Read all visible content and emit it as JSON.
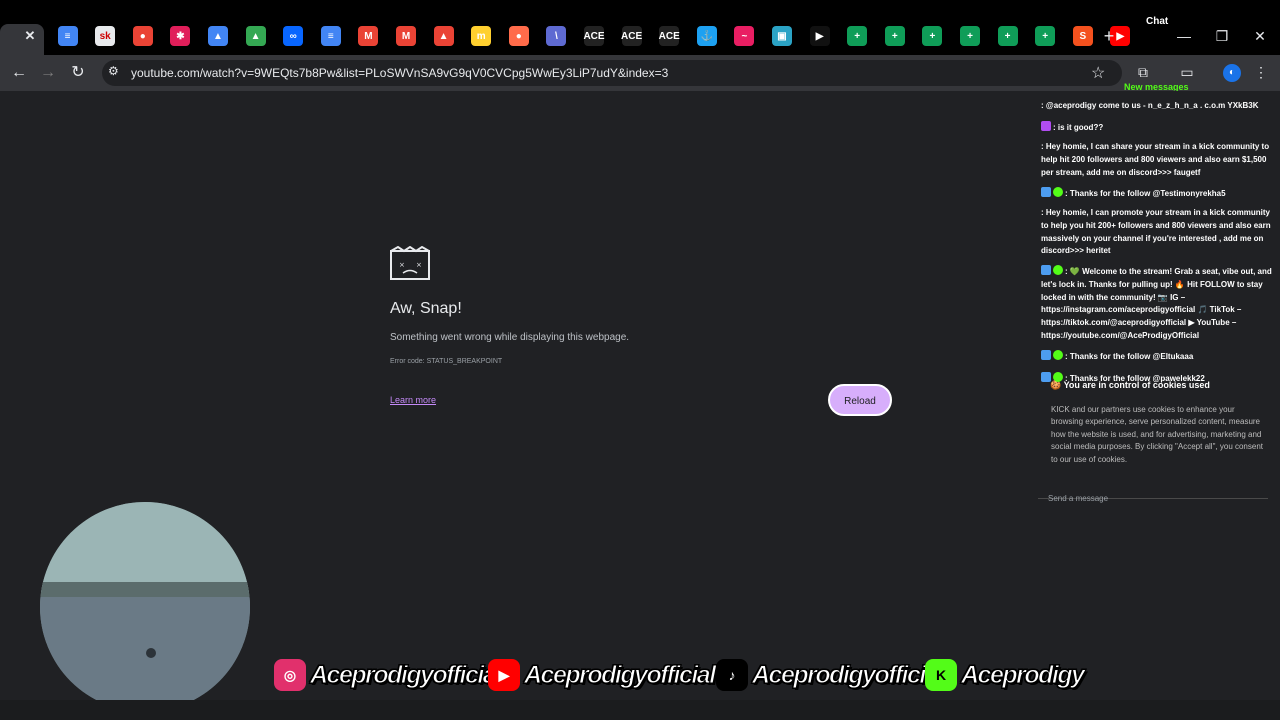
{
  "browser": {
    "chat_label": "Chat",
    "tabs": [
      {
        "icon": "close-icon",
        "label": "✕",
        "color": "#35363a"
      },
      {
        "icon": "google-docs-icon",
        "label": "≡",
        "color": "#4285f4"
      },
      {
        "icon": "sk-icon",
        "label": "sk",
        "color": "#e8eaed"
      },
      {
        "icon": "app-icon",
        "label": "●",
        "color": "#ea4335"
      },
      {
        "icon": "slack-icon",
        "label": "✱",
        "color": "#e01e5a"
      },
      {
        "icon": "google-ads-icon",
        "label": "▲",
        "color": "#4285f4"
      },
      {
        "icon": "google-drive-icon",
        "label": "▲",
        "color": "#34a853"
      },
      {
        "icon": "meta-icon",
        "label": "∞",
        "color": "#0866ff"
      },
      {
        "icon": "google-docs-icon",
        "label": "≡",
        "color": "#4285f4"
      },
      {
        "icon": "gmail-icon",
        "label": "M",
        "color": "#ea4335"
      },
      {
        "icon": "gmail-icon",
        "label": "M",
        "color": "#ea4335"
      },
      {
        "icon": "app-icon",
        "label": "▲",
        "color": "#ea4335"
      },
      {
        "icon": "miro-icon",
        "label": "m",
        "color": "#ffd02f"
      },
      {
        "icon": "app-icon",
        "label": "●",
        "color": "#ff6b4a"
      },
      {
        "icon": "linear-icon",
        "label": "\\",
        "color": "#5e6ad2"
      },
      {
        "icon": "ace-icon",
        "label": "ACE",
        "color": "#222222"
      },
      {
        "icon": "ace-icon",
        "label": "ACE",
        "color": "#222222"
      },
      {
        "icon": "ace-icon",
        "label": "ACE",
        "color": "#222222"
      },
      {
        "icon": "app-icon",
        "label": "⚓",
        "color": "#1da1f2"
      },
      {
        "icon": "app-icon",
        "label": "~",
        "color": "#e91e63"
      },
      {
        "icon": "app-icon",
        "label": "▣",
        "color": "#2ba3c5"
      },
      {
        "icon": "app-icon",
        "label": "▶",
        "color": "#111111"
      },
      {
        "icon": "google-sheets-icon",
        "label": "+",
        "color": "#0f9d58"
      },
      {
        "icon": "google-sheets-icon",
        "label": "+",
        "color": "#0f9d58"
      },
      {
        "icon": "google-sheets-icon",
        "label": "+",
        "color": "#0f9d58"
      },
      {
        "icon": "google-sheets-icon",
        "label": "+",
        "color": "#0f9d58"
      },
      {
        "icon": "google-sheets-icon",
        "label": "+",
        "color": "#0f9d58"
      },
      {
        "icon": "google-sheets-icon",
        "label": "+",
        "color": "#0f9d58"
      },
      {
        "icon": "app-icon",
        "label": "S",
        "color": "#f4511e"
      },
      {
        "icon": "youtube-icon",
        "label": "▶",
        "color": "#ff0000"
      }
    ],
    "url": "youtube.com/watch?v=9WEQts7b8Pw&list=PLoSWVnSA9vG9qV0CVCpg5WwEy3LiP7udY&index=3",
    "new_messages": "New messages"
  },
  "error_page": {
    "title": "Aw, Snap!",
    "message": "Something went wrong while displaying this webpage.",
    "error_code": "Error code: STATUS_BREAKPOINT",
    "learn_more": "Learn more",
    "reload": "Reload"
  },
  "chat": {
    "messages": [
      {
        "badges": [],
        "text": ": @aceprodigy come to us - n_e_z_h_n_a . c.o.m YXkB3K"
      },
      {
        "badges": [
          "mic"
        ],
        "text": ": is it good??"
      },
      {
        "badges": [],
        "text": ": Hey homie, I can share your stream in a kick community to help hit 200 followers and 800 viewers and also earn $1,500 per stream, add me on discord>>> faugetf"
      },
      {
        "badges": [
          "bot",
          "verified"
        ],
        "text": ": Thanks for the follow @Testimonyrekha5"
      },
      {
        "badges": [],
        "text": ": Hey homie, I can promote your stream in a kick community to help you hit 200+ followers and 800 viewers and also earn massively on your channel if you're interested , add me on discord>>> heritet"
      },
      {
        "badges": [
          "bot",
          "verified"
        ],
        "text": ": 💚 Welcome to the stream! Grab a seat, vibe out, and let's lock in. Thanks for pulling up! 🔥 Hit FOLLOW to stay locked in with the community! 📷 IG – https://instagram.com/aceprodigyofficial 🎵 TikTok – https://tiktok.com/@aceprodigyofficial ▶ YouTube – https://youtube.com/@AceProdigyOfficial"
      },
      {
        "badges": [
          "bot",
          "verified"
        ],
        "text": ": Thanks for the follow @Eltukaaa"
      },
      {
        "badges": [
          "bot",
          "verified"
        ],
        "text": ": Thanks for the follow @pawelekk22"
      }
    ],
    "cookie_title": "You are in control of cookies used",
    "cookie_body": "KICK and our partners use cookies to enhance your browsing experience, serve personalized content, measure how the website is used, and for advertising, marketing and social media purposes. By clicking \"Accept all\", you consent to our use of cookies.",
    "send_placeholder": "Send a message"
  },
  "socials": [
    {
      "icon": "instagram-icon",
      "handle": "Aceprodigyofficial",
      "color": "#e1306c"
    },
    {
      "icon": "youtube-icon",
      "handle": "Aceprodigyofficial",
      "color": "#ff0000"
    },
    {
      "icon": "tiktok-icon",
      "handle": "Aceprodigyofficial",
      "color": "#000000"
    },
    {
      "icon": "kick-icon",
      "handle": "Aceprodigy",
      "color": "#53fc18"
    }
  ]
}
